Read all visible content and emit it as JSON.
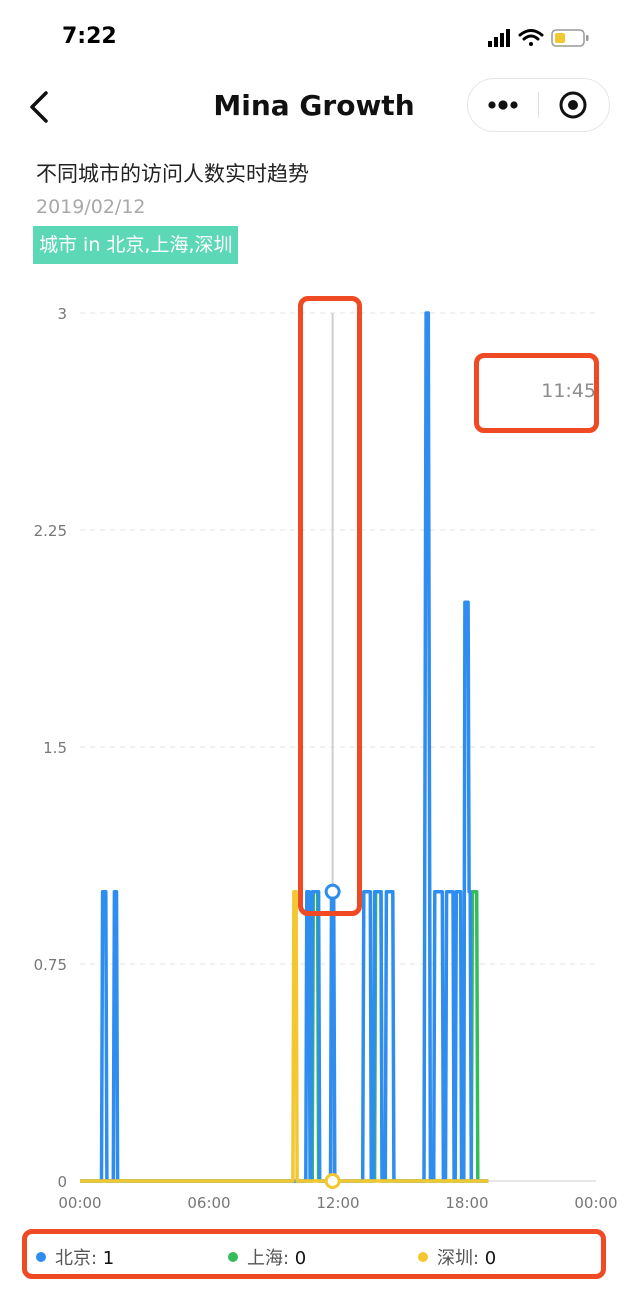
{
  "status_bar": {
    "time": "7:22"
  },
  "nav": {
    "title": "Mina Growth"
  },
  "header": {
    "title": "不同城市的访问人数实时趋势",
    "date": "2019/02/12",
    "filter": "城市 in 北京,上海,深圳"
  },
  "tooltip": {
    "time": "11:45"
  },
  "colors": {
    "beijing": "#2e8def",
    "shanghai": "#33bc5a",
    "shenzhen": "#f3c730",
    "highlight": "#f04a24",
    "tag": "#5cd8b6"
  },
  "chart_data": {
    "type": "line",
    "y_ticks": [
      "3",
      "2.25",
      "1.5",
      "0.75",
      "0"
    ],
    "x_ticks": [
      "00:00",
      "06:00",
      "12:00",
      "18:00",
      "00:00"
    ],
    "ylim": [
      0,
      3
    ],
    "grid": true,
    "crosshair_x": "11:45",
    "series": [
      {
        "name": "北京",
        "color": "#2e8def",
        "points": [
          [
            "00:00",
            0
          ],
          [
            "01:00",
            0
          ],
          [
            "01:03",
            1
          ],
          [
            "01:12",
            1
          ],
          [
            "01:15",
            0
          ],
          [
            "01:33",
            0
          ],
          [
            "01:36",
            1
          ],
          [
            "01:42",
            1
          ],
          [
            "01:45",
            0
          ],
          [
            "10:30",
            0
          ],
          [
            "10:33",
            1
          ],
          [
            "10:39",
            1
          ],
          [
            "10:42",
            0
          ],
          [
            "10:45",
            0
          ],
          [
            "10:48",
            1
          ],
          [
            "11:06",
            1
          ],
          [
            "11:09",
            0
          ],
          [
            "11:39",
            0
          ],
          [
            "11:42",
            1
          ],
          [
            "11:48",
            1
          ],
          [
            "11:51",
            0
          ],
          [
            "13:09",
            0
          ],
          [
            "13:12",
            1
          ],
          [
            "13:30",
            1
          ],
          [
            "13:33",
            0
          ],
          [
            "13:39",
            0
          ],
          [
            "13:42",
            1
          ],
          [
            "14:00",
            1
          ],
          [
            "14:03",
            0
          ],
          [
            "14:12",
            0
          ],
          [
            "14:15",
            1
          ],
          [
            "14:33",
            1
          ],
          [
            "14:36",
            0
          ],
          [
            "16:00",
            0
          ],
          [
            "16:06",
            3
          ],
          [
            "16:12",
            3
          ],
          [
            "16:18",
            0
          ],
          [
            "16:27",
            0
          ],
          [
            "16:30",
            1
          ],
          [
            "16:51",
            1
          ],
          [
            "16:54",
            0
          ],
          [
            "17:00",
            0
          ],
          [
            "17:03",
            1
          ],
          [
            "17:21",
            1
          ],
          [
            "17:24",
            0
          ],
          [
            "17:27",
            0
          ],
          [
            "17:30",
            1
          ],
          [
            "17:42",
            1
          ],
          [
            "17:45",
            0
          ],
          [
            "17:51",
            0
          ],
          [
            "17:54",
            2
          ],
          [
            "18:03",
            2
          ],
          [
            "18:06",
            1
          ],
          [
            "18:09",
            1
          ],
          [
            "18:12",
            0
          ],
          [
            "19:00",
            0
          ]
        ]
      },
      {
        "name": "上海",
        "color": "#33bc5a",
        "points": [
          [
            "00:00",
            0
          ],
          [
            "10:48",
            0
          ],
          [
            "10:51",
            1
          ],
          [
            "11:03",
            1
          ],
          [
            "11:06",
            0
          ],
          [
            "13:42",
            0
          ],
          [
            "13:45",
            1
          ],
          [
            "14:00",
            1
          ],
          [
            "14:03",
            0
          ],
          [
            "18:12",
            0
          ],
          [
            "18:15",
            1
          ],
          [
            "18:27",
            1
          ],
          [
            "18:30",
            0
          ],
          [
            "19:00",
            0
          ]
        ]
      },
      {
        "name": "深圳",
        "color": "#f3c730",
        "points": [
          [
            "00:00",
            0
          ],
          [
            "09:54",
            0
          ],
          [
            "09:57",
            1
          ],
          [
            "10:03",
            1
          ],
          [
            "10:06",
            0
          ],
          [
            "19:00",
            0
          ]
        ]
      }
    ]
  },
  "legend": [
    {
      "name": "北京",
      "value": "1",
      "color": "#2e8def"
    },
    {
      "name": "上海",
      "value": "0",
      "color": "#33bc5a"
    },
    {
      "name": "深圳",
      "value": "0",
      "color": "#f3c730"
    }
  ]
}
